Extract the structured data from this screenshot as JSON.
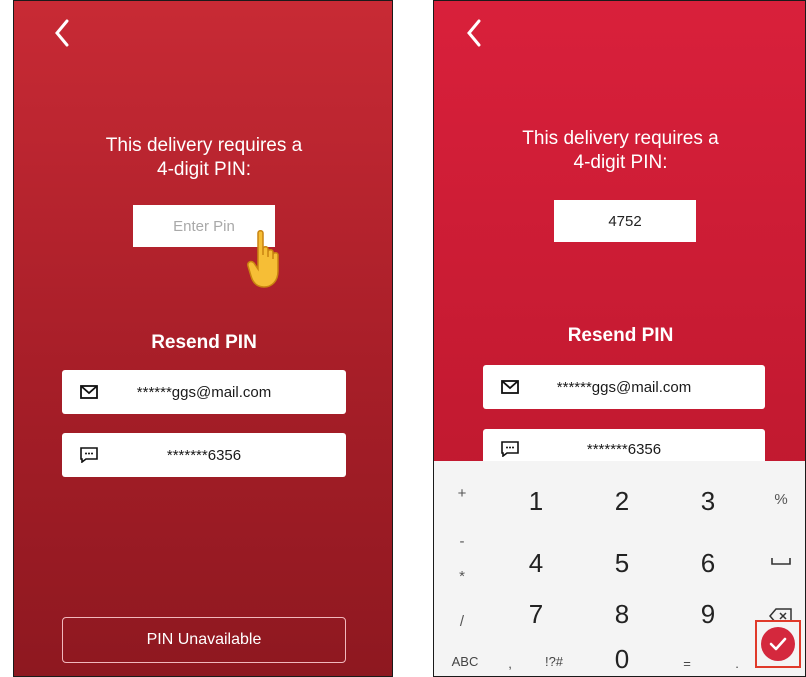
{
  "left": {
    "back_icon": "chevron-left-icon",
    "title_line1": "This delivery requires a",
    "title_line2": "4-digit PIN:",
    "pin_placeholder": "Enter Pin",
    "resend_label": "Resend PIN",
    "email_masked": "******ggs@mail.com",
    "phone_masked": "*******6356",
    "unavailable_label": "PIN Unavailable",
    "pointer_icon": "pointing-hand-icon"
  },
  "right": {
    "back_icon": "chevron-left-icon",
    "title_line1": "This delivery requires a",
    "title_line2": "4-digit PIN:",
    "pin_value": "4752",
    "resend_label": "Resend PIN",
    "email_masked": "******ggs@mail.com",
    "phone_masked": "*******6356"
  },
  "keyboard": {
    "left_symbols": [
      "+",
      "-",
      "*",
      "/"
    ],
    "digits": [
      "1",
      "2",
      "3",
      "4",
      "5",
      "6",
      "7",
      "8",
      "9",
      "0"
    ],
    "right_symbols": [
      "%"
    ],
    "bottom_row": [
      "ABC",
      ",",
      "!?#",
      "=",
      "."
    ],
    "enter_icon": "checkmark-icon"
  },
  "colors": {
    "left_bg": "#b5222c",
    "right_bg": "#cd1c36",
    "highlight": "#e03a2a"
  }
}
